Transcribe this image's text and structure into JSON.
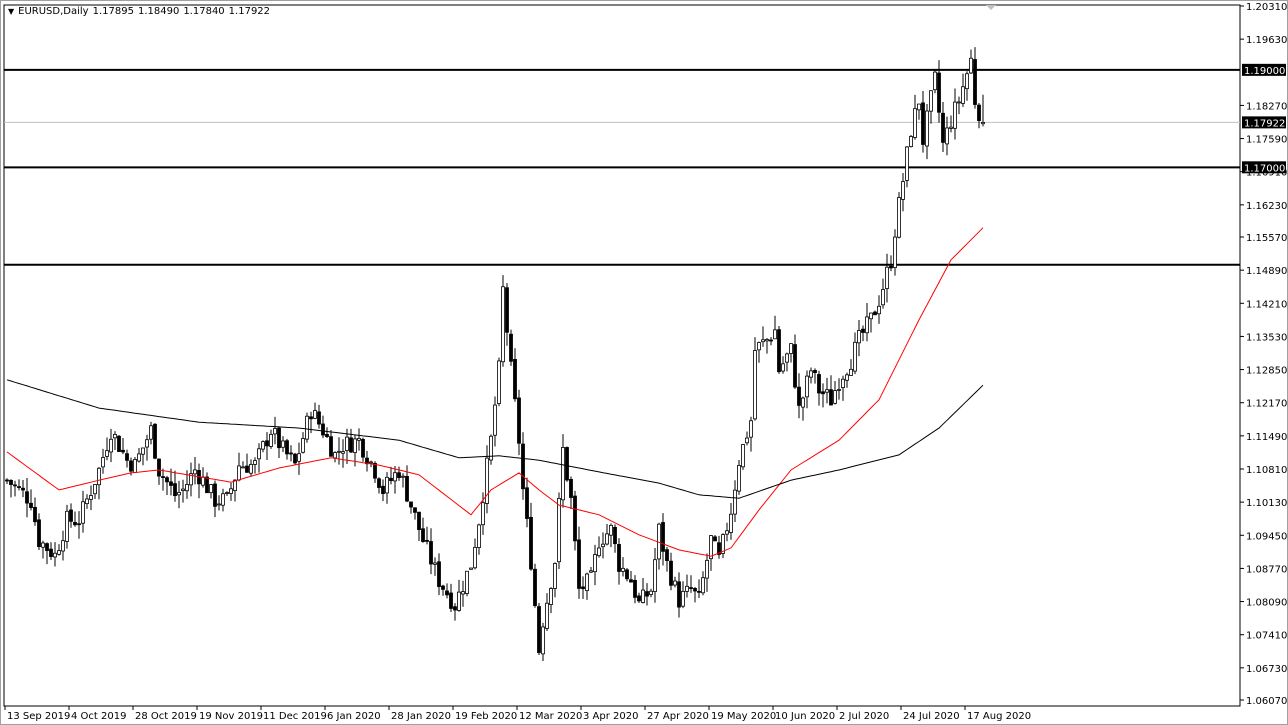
{
  "header": {
    "symbol_timeframe": "EURUSD,Daily",
    "open": "1.17895",
    "high": "1.18490",
    "low": "1.17840",
    "close": "1.17922",
    "menu_icon": "triangle-down-icon"
  },
  "colors": {
    "background": "#ffffff",
    "candle": "#000000",
    "ma_fast": "#ff0000",
    "ma_slow": "#000000",
    "price_line": "#c0c0c0",
    "tag_bg": "#000000"
  },
  "chart_data": {
    "type": "candlestick",
    "title": "EURUSD,Daily",
    "ylim": [
      1.0607,
      1.2031
    ],
    "y_ticks": [
      "1.20310",
      "1.19630",
      "1.18270",
      "1.17590",
      "1.16910",
      "1.16230",
      "1.15570",
      "1.14890",
      "1.14210",
      "1.13530",
      "1.12850",
      "1.12170",
      "1.11490",
      "1.10810",
      "1.10130",
      "1.09450",
      "1.08770",
      "1.08090",
      "1.07410",
      "1.06730",
      "1.06070"
    ],
    "x_ticks": [
      "13 Sep 2019",
      "4 Oct 2019",
      "28 Oct 2019",
      "19 Nov 2019",
      "11 Dec 2019",
      "6 Jan 2020",
      "28 Jan 2020",
      "19 Feb 2020",
      "12 Mar 2020",
      "3 Apr 2020",
      "27 Apr 2020",
      "19 May 2020",
      "10 Jun 2020",
      "2 Jul 2020",
      "24 Jul 2020",
      "17 Aug 2020"
    ],
    "x_tick_bar_index": [
      0,
      16,
      32,
      48,
      64,
      80,
      96,
      112,
      128,
      144,
      160,
      176,
      192,
      208,
      224,
      240
    ],
    "bar_count": 245,
    "close_keypoints": [
      [
        0,
        1.1058
      ],
      [
        3,
        1.1038
      ],
      [
        6,
        1.1017
      ],
      [
        8,
        1.0935
      ],
      [
        12,
        1.0904
      ],
      [
        15,
        1.0976
      ],
      [
        18,
        1.0976
      ],
      [
        21,
        1.1038
      ],
      [
        23,
        1.1079
      ],
      [
        26,
        1.1161
      ],
      [
        30,
        1.1099
      ],
      [
        32,
        1.1089
      ],
      [
        36,
        1.1161
      ],
      [
        38,
        1.1079
      ],
      [
        42,
        1.1028
      ],
      [
        44,
        1.1038
      ],
      [
        47,
        1.1079
      ],
      [
        49,
        1.1058
      ],
      [
        52,
        1.1017
      ],
      [
        55,
        1.1017
      ],
      [
        58,
        1.1089
      ],
      [
        62,
        1.1089
      ],
      [
        66,
        1.1161
      ],
      [
        69,
        1.112
      ],
      [
        72,
        1.1089
      ],
      [
        76,
        1.1202
      ],
      [
        79,
        1.1161
      ],
      [
        82,
        1.111
      ],
      [
        84,
        1.113
      ],
      [
        88,
        1.114
      ],
      [
        92,
        1.1079
      ],
      [
        94,
        1.1038
      ],
      [
        98,
        1.1079
      ],
      [
        101,
        1.1007
      ],
      [
        104,
        1.0935
      ],
      [
        108,
        1.0853
      ],
      [
        112,
        1.0802
      ],
      [
        116,
        1.0886
      ],
      [
        118,
        1.0976
      ],
      [
        121,
        1.114
      ],
      [
        123,
        1.1284
      ],
      [
        124,
        1.1448
      ],
      [
        126,
        1.1284
      ],
      [
        128,
        1.114
      ],
      [
        129,
        1.1038
      ],
      [
        131,
        1.0894
      ],
      [
        133,
        1.071
      ],
      [
        134,
        1.0771
      ],
      [
        137,
        1.0894
      ],
      [
        139,
        1.112
      ],
      [
        141,
        1.1017
      ],
      [
        143,
        1.0833
      ],
      [
        146,
        1.0853
      ],
      [
        148,
        1.0935
      ],
      [
        151,
        1.0956
      ],
      [
        153,
        1.0886
      ],
      [
        156,
        1.0853
      ],
      [
        158,
        1.0804
      ],
      [
        161,
        1.0833
      ],
      [
        163,
        1.0956
      ],
      [
        165,
        1.0886
      ],
      [
        168,
        1.0812
      ],
      [
        171,
        1.0833
      ],
      [
        173,
        1.0812
      ],
      [
        176,
        1.0935
      ],
      [
        178,
        1.0894
      ],
      [
        181,
        1.0997
      ],
      [
        183,
        1.1099
      ],
      [
        186,
        1.1181
      ],
      [
        187,
        1.1325
      ],
      [
        190,
        1.1346
      ],
      [
        192,
        1.1366
      ],
      [
        193,
        1.1284
      ],
      [
        196,
        1.1325
      ],
      [
        198,
        1.1202
      ],
      [
        201,
        1.1284
      ],
      [
        203,
        1.1243
      ],
      [
        206,
        1.1223
      ],
      [
        208,
        1.1264
      ],
      [
        211,
        1.1305
      ],
      [
        213,
        1.1346
      ],
      [
        216,
        1.1387
      ],
      [
        218,
        1.1428
      ],
      [
        221,
        1.151
      ],
      [
        222,
        1.1571
      ],
      [
        224,
        1.1674
      ],
      [
        226,
        1.1777
      ],
      [
        228,
        1.1838
      ],
      [
        229,
        1.1756
      ],
      [
        232,
        1.1879
      ],
      [
        234,
        1.1746
      ],
      [
        236,
        1.1797
      ],
      [
        238,
        1.1838
      ],
      [
        241,
        1.192
      ],
      [
        242,
        1.1838
      ],
      [
        244,
        1.17922
      ]
    ],
    "last_bar": {
      "open": 1.17895,
      "high": 1.1849,
      "low": 1.1784,
      "close": 1.17922
    },
    "ma_fast": {
      "name": "MA fast (red)",
      "keypoints": [
        [
          0,
          1.1116
        ],
        [
          13,
          1.1038
        ],
        [
          23,
          1.1058
        ],
        [
          31,
          1.1073
        ],
        [
          38,
          1.1079
        ],
        [
          56,
          1.1054
        ],
        [
          68,
          1.1083
        ],
        [
          81,
          1.1104
        ],
        [
          93,
          1.1089
        ],
        [
          103,
          1.1069
        ],
        [
          116,
          1.0987
        ],
        [
          121,
          1.1038
        ],
        [
          128,
          1.1073
        ],
        [
          133,
          1.1038
        ],
        [
          138,
          1.1007
        ],
        [
          148,
          1.0987
        ],
        [
          158,
          1.0946
        ],
        [
          168,
          1.0915
        ],
        [
          176,
          1.0902
        ],
        [
          181,
          1.0919
        ],
        [
          188,
          1.0997
        ],
        [
          196,
          1.1079
        ],
        [
          208,
          1.114
        ],
        [
          218,
          1.1223
        ],
        [
          228,
          1.1387
        ],
        [
          236,
          1.151
        ],
        [
          244,
          1.1576
        ]
      ]
    },
    "ma_slow": {
      "name": "MA slow (black)",
      "keypoints": [
        [
          0,
          1.1264
        ],
        [
          23,
          1.1206
        ],
        [
          48,
          1.1177
        ],
        [
          73,
          1.1165
        ],
        [
          98,
          1.114
        ],
        [
          113,
          1.1104
        ],
        [
          123,
          1.1108
        ],
        [
          133,
          1.1099
        ],
        [
          148,
          1.1075
        ],
        [
          163,
          1.1052
        ],
        [
          173,
          1.1028
        ],
        [
          183,
          1.1021
        ],
        [
          196,
          1.1058
        ],
        [
          208,
          1.1079
        ],
        [
          223,
          1.111
        ],
        [
          233,
          1.1165
        ],
        [
          244,
          1.1253
        ]
      ]
    },
    "horizontal_lines": [
      {
        "price": 1.19,
        "label": "1.19000"
      },
      {
        "price": 1.17,
        "label": "1.17000"
      },
      {
        "price": 1.15,
        "label": ""
      }
    ],
    "current_price": {
      "price": 1.17922,
      "label": "1.17922"
    }
  }
}
